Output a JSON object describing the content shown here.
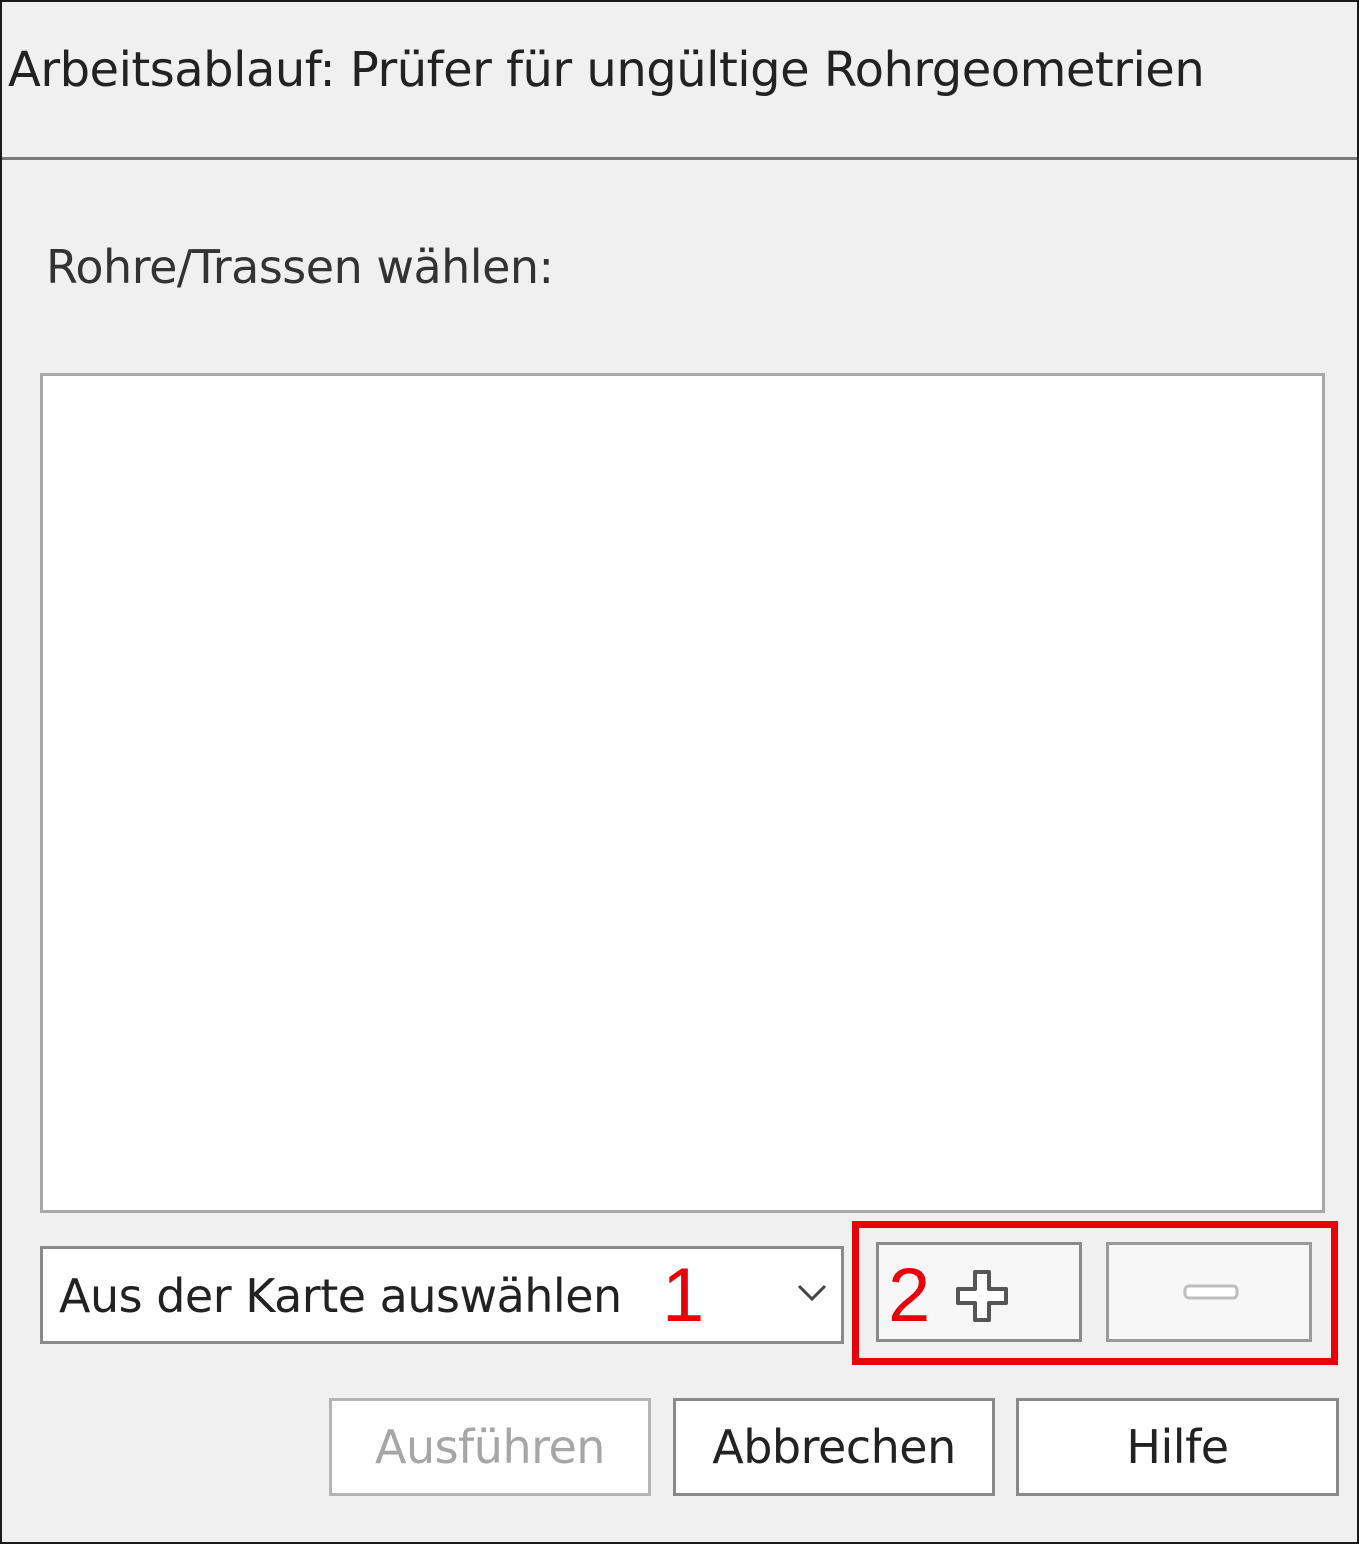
{
  "window": {
    "title": "Arbeitsablauf: Prüfer für ungültige Rohrgeometrien"
  },
  "selection": {
    "label": "Rohre/Trassen wählen:",
    "items": [],
    "source_dropdown": {
      "selected": "Aus der Karte auswählen"
    },
    "add_icon": "plus-icon",
    "remove_icon": "minus-icon"
  },
  "callouts": {
    "one": "1",
    "two": "2",
    "color": "#e8000b"
  },
  "actions": {
    "run_label": "Ausführen",
    "run_enabled": false,
    "cancel_label": "Abbrechen",
    "help_label": "Hilfe"
  }
}
